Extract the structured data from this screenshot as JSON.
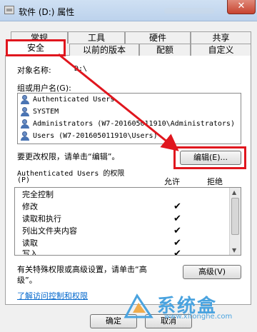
{
  "window": {
    "title": "软件 (D:) 属性",
    "close_glyph": "✕"
  },
  "tabs_row1": [
    "常规",
    "工具",
    "硬件",
    "共享"
  ],
  "tabs_row2": [
    "安全",
    "以前的版本",
    "配额",
    "自定义"
  ],
  "active_tab": "安全",
  "security": {
    "object_name_label": "对象名称:",
    "object_name_value": "D:\\",
    "groups_label": "组或用户名(G):",
    "users": [
      "Authenticated Users",
      "SYSTEM",
      "Administrators (W7-201605011910\\Administrators)",
      "Users (W7-201605011910\\Users)"
    ],
    "change_hint": "要更改权限，请单击“编辑”。",
    "edit_button": "编辑(E)...",
    "perm_title_line1": "Authenticated Users 的权限",
    "perm_title_line2": "(P)",
    "allow_header": "允许",
    "deny_header": "拒绝",
    "permissions": [
      {
        "name": "完全控制",
        "allow": ""
      },
      {
        "name": "修改",
        "allow": "✔"
      },
      {
        "name": "读取和执行",
        "allow": "✔"
      },
      {
        "name": "列出文件夹内容",
        "allow": "✔"
      },
      {
        "name": "读取",
        "allow": "✔"
      },
      {
        "name": "写入",
        "allow": "✔"
      }
    ],
    "advanced_hint_line1": "有关特殊权限或高级设置，请单击“高",
    "advanced_hint_line2": "级”。",
    "advanced_button": "高级(V)",
    "learn_link": "了解访问控制和权限"
  },
  "footer": {
    "ok_button": "确定",
    "cancel_button": "取消"
  },
  "watermark": {
    "text": "系统盒",
    "url": "www.xitonghe.com"
  },
  "colors": {
    "highlight_red": "#e0161e",
    "link_blue": "#0066cc"
  }
}
